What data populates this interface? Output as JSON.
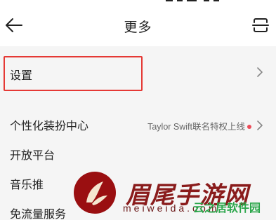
{
  "header": {
    "title": "更多",
    "back_icon": "arrow-left-icon",
    "scan_icon": "scan-icon"
  },
  "settings_row": {
    "label": "设置",
    "chevron_icon": "chevron-right-icon"
  },
  "menu": {
    "items": [
      {
        "label": "个性化装扮中心",
        "extra": "Taylor Swift联名特权上线",
        "has_dot": true,
        "chevron": true
      },
      {
        "label": "开放平台"
      },
      {
        "label": "音乐推"
      },
      {
        "label": "免流量服务"
      }
    ]
  },
  "watermark": {
    "text": "眉尾手游网",
    "url": "meiweida.com",
    "subtext": "云之居软件园"
  },
  "colors": {
    "highlight_border": "#e53935",
    "dot": "#ec4b58",
    "background": "#f5f5f5",
    "header_bg": "#ffffff"
  }
}
